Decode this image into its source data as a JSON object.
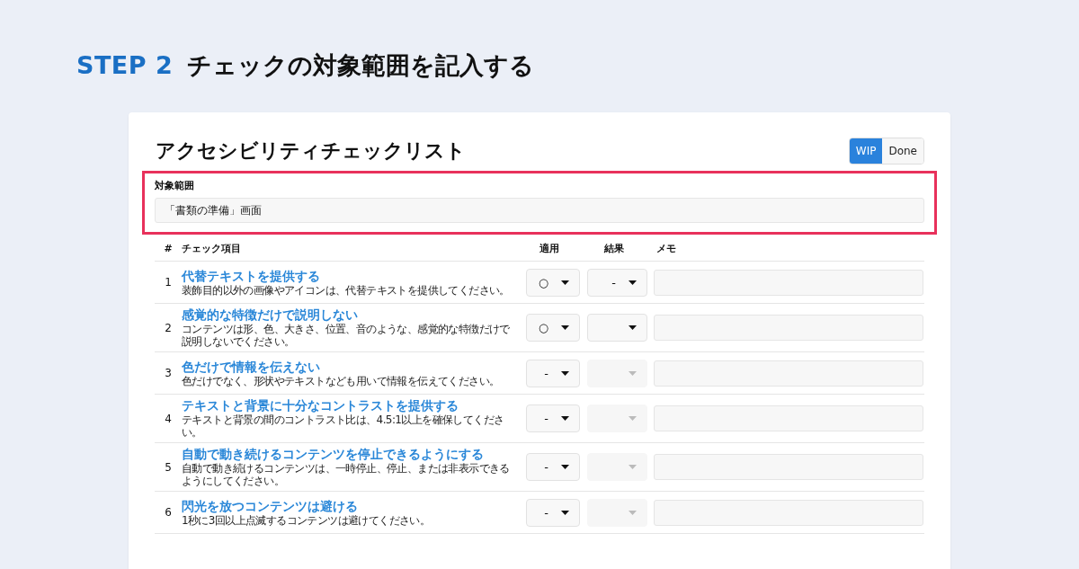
{
  "step": {
    "label": "STEP 2",
    "title": "チェックの対象範囲を記入する"
  },
  "card": {
    "title": "アクセシビリティチェックリスト",
    "status_toggle": [
      {
        "label": "WIP",
        "selected": true
      },
      {
        "label": "Done",
        "selected": false
      }
    ],
    "scope": {
      "label": "対象範囲",
      "value": "「書類の準備」画面",
      "highlighted": true
    },
    "table": {
      "columns": [
        "#",
        "チェック項目",
        "適用",
        "結果",
        "メモ"
      ],
      "rows": [
        {
          "number": "1",
          "title": "代替テキストを提供する",
          "description": "装飾目的以外の画像やアイコンは、代替テキストを提供してください。",
          "apply": {
            "value": "○",
            "disabled": false
          },
          "result": {
            "value": "-",
            "disabled": false
          }
        },
        {
          "number": "2",
          "title": "感覚的な特徴だけで説明しない",
          "description": "コンテンツは形、色、大きさ、位置、音のような、感覚的な特徴だけで説明しないでください。",
          "apply": {
            "value": "○",
            "disabled": false
          },
          "result": {
            "disabled": false
          }
        },
        {
          "number": "3",
          "title": "色だけで情報を伝えない",
          "description": "色だけでなく、形状やテキストなども用いて情報を伝えてください。",
          "apply": {
            "value": "-",
            "disabled": false
          },
          "result": {
            "disabled": true
          }
        },
        {
          "number": "4",
          "title": "テキストと背景に十分なコントラストを提供する",
          "description": "テキストと背景の間のコントラスト比は、4.5:1以上を確保してください。",
          "apply": {
            "value": "-",
            "disabled": false
          },
          "result": {
            "disabled": true
          }
        },
        {
          "number": "5",
          "title": "自動で動き続けるコンテンツを停止できるようにする",
          "description": "自動で動き続けるコンテンツは、一時停止、停止、または非表示できるようにしてください。",
          "apply": {
            "value": "-",
            "disabled": false
          },
          "result": {
            "disabled": true
          }
        },
        {
          "number": "6",
          "title": "閃光を放つコンテンツは避ける",
          "description": "1秒に3回以上点滅するコンテンツは避けてください。",
          "apply": {
            "value": "-",
            "disabled": false
          },
          "result": {
            "disabled": true
          }
        }
      ]
    }
  }
}
